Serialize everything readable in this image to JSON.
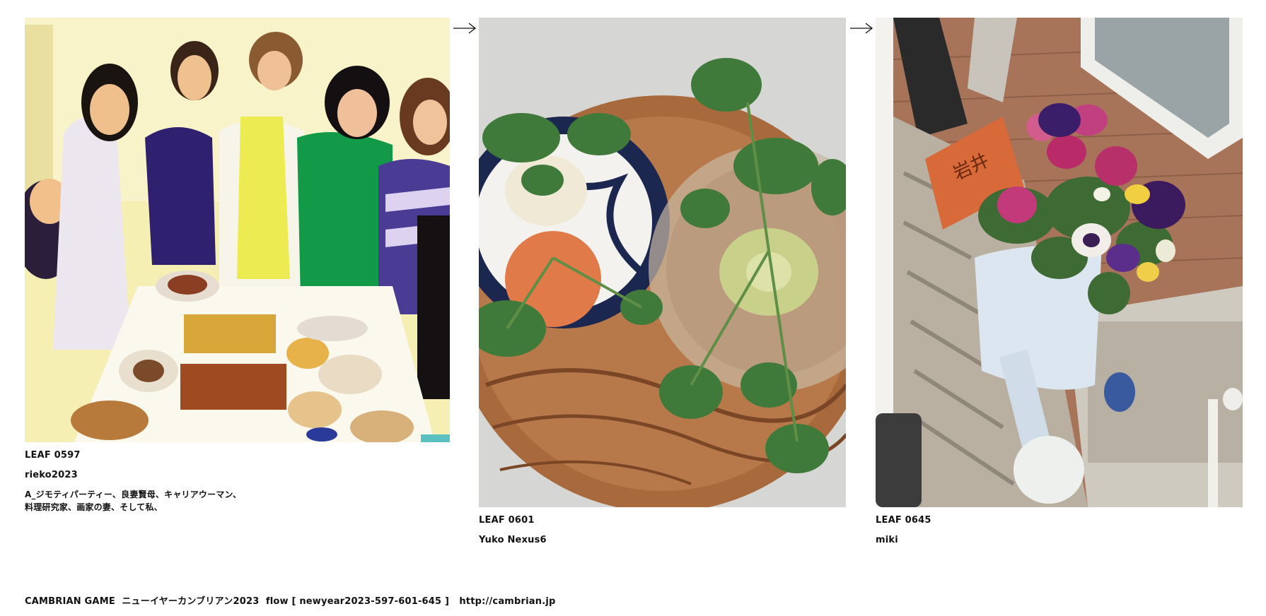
{
  "leaves": [
    {
      "id": "LEAF 0597",
      "author": "rieko2023",
      "description": "A_ジモティパーティー、良妻賢母、キャリアウーマン、\n料理研究家、画家の妻、そして私、",
      "image": "painting of women at a party table"
    },
    {
      "id": "LEAF 0601",
      "author": "Yuko Nexus6",
      "image": "turnips with greens on a wooden tray"
    },
    {
      "id": "LEAF 0645",
      "author": "miki",
      "image": "pansies in a watering can pot with nameplate"
    }
  ],
  "arrows": [
    "right-arrow-icon",
    "right-arrow-icon"
  ],
  "footer": {
    "text": "CAMBRIAN GAME  ニューイヤーカンブリアン2023  flow [ newyear2023-597-601-645 ]",
    "link": "http://cambrian.jp"
  }
}
